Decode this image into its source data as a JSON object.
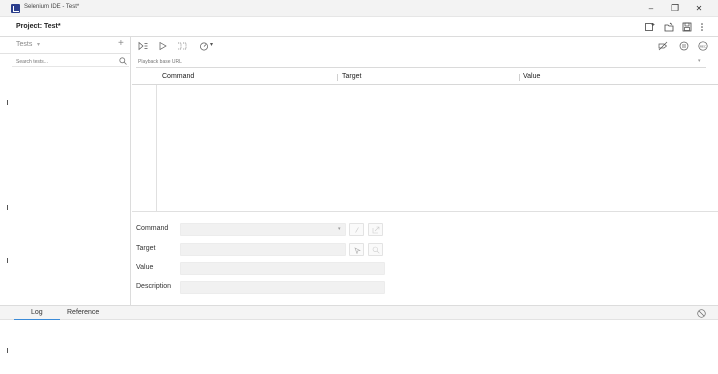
{
  "window": {
    "title": "Selenium IDE - Test*",
    "buttons": {
      "minimize": "–",
      "maximize": "❐",
      "close": "✕"
    }
  },
  "project": {
    "label": "Project:  Test*"
  },
  "sidebar": {
    "tests_label": "Tests",
    "tests_caret": "▾",
    "add_symbol": "+",
    "search_placeholder": "Search tests..."
  },
  "toolbar": {
    "speed_caret": "▾"
  },
  "url_bar": {
    "placeholder": "Playback base URL",
    "caret": "▾"
  },
  "table": {
    "headers": [
      "Command",
      "Target",
      "Value"
    ]
  },
  "editor": {
    "labels": [
      "Command",
      "Target",
      "Value",
      "Description"
    ],
    "command_caret": "▾"
  },
  "bottom_panel": {
    "tabs": [
      "Log",
      "Reference"
    ]
  },
  "colors": {
    "accent": "#3b8bd8",
    "app_icon": "#2b3e8c",
    "field_bg": "#f1f1f1"
  }
}
